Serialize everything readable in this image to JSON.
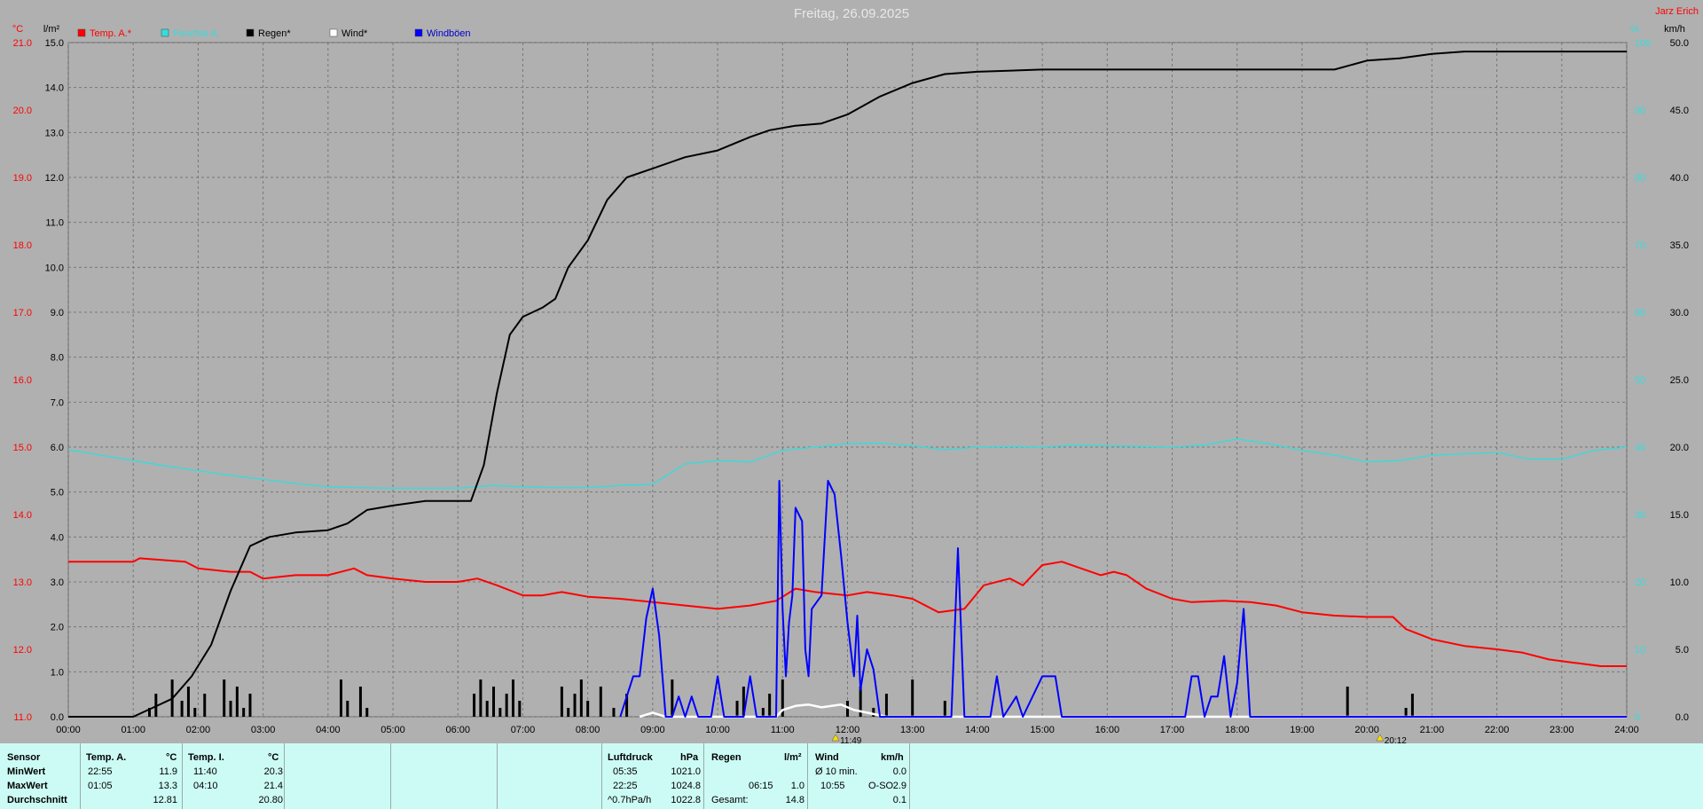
{
  "header": {
    "title": "Freitag, 26.09.2025",
    "author": "Jarz Erich",
    "left_units": [
      "°C",
      "l/m²"
    ],
    "right_units": [
      "%",
      "km/h"
    ]
  },
  "colors": {
    "bg": "#b0b0b0",
    "temp": "#ff0000",
    "humidity": "#33dddd",
    "rain": "#000000",
    "wind": "#ffffff",
    "gust": "#0000ff",
    "panel": "#ccfbf5"
  },
  "chart_data": {
    "type": "line",
    "title": "Freitag, 26.09.2025",
    "x_ticks": [
      "00:00",
      "01:00",
      "02:00",
      "03:00",
      "04:00",
      "05:00",
      "06:00",
      "07:00",
      "08:00",
      "09:00",
      "10:00",
      "11:00",
      "12:00",
      "13:00",
      "14:00",
      "15:00",
      "16:00",
      "17:00",
      "18:00",
      "19:00",
      "20:00",
      "21:00",
      "22:00",
      "23:00",
      "24:00"
    ],
    "xlim": [
      0,
      24
    ],
    "axis_temp": {
      "range": [
        11.0,
        21.0
      ],
      "ticks": [
        "11.0",
        "12.0",
        "13.0",
        "14.0",
        "15.0",
        "16.0",
        "17.0",
        "18.0",
        "19.0",
        "20.0",
        "21.0"
      ]
    },
    "axis_rain": {
      "range": [
        0,
        15.0
      ],
      "ticks": [
        "0.0",
        "1.0",
        "2.0",
        "3.0",
        "4.0",
        "5.0",
        "6.0",
        "7.0",
        "8.0",
        "9.0",
        "10.0",
        "11.0",
        "12.0",
        "13.0",
        "14.0",
        "15.0"
      ]
    },
    "axis_hum": {
      "range": [
        0,
        100
      ],
      "ticks": [
        "0",
        "10",
        "20",
        "30",
        "40",
        "50",
        "60",
        "70",
        "80",
        "90",
        "100"
      ]
    },
    "axis_wind": {
      "range": [
        0,
        50.0
      ],
      "ticks": [
        "0.0",
        "5.0",
        "10.0",
        "15.0",
        "20.0",
        "25.0",
        "30.0",
        "35.0",
        "40.0",
        "45.0",
        "50.0"
      ]
    },
    "legend": [
      "Temp. A.*",
      "Feuchte A.",
      "Regen*",
      "Wind*",
      "Windböen"
    ],
    "markers": [
      "11:49",
      "20:12"
    ],
    "series": [
      {
        "name": "Temp. A.*",
        "axis": "temp",
        "points": [
          [
            0,
            13.3
          ],
          [
            1.0,
            13.3
          ],
          [
            1.1,
            13.35
          ],
          [
            1.8,
            13.3
          ],
          [
            2.0,
            13.2
          ],
          [
            2.5,
            13.15
          ],
          [
            2.8,
            13.15
          ],
          [
            3.0,
            13.05
          ],
          [
            3.5,
            13.1
          ],
          [
            4.0,
            13.1
          ],
          [
            4.4,
            13.2
          ],
          [
            4.6,
            13.1
          ],
          [
            5.0,
            13.05
          ],
          [
            5.5,
            13.0
          ],
          [
            6.0,
            13.0
          ],
          [
            6.3,
            13.05
          ],
          [
            6.6,
            12.95
          ],
          [
            7.0,
            12.8
          ],
          [
            7.3,
            12.8
          ],
          [
            7.6,
            12.85
          ],
          [
            8.0,
            12.78
          ],
          [
            8.5,
            12.75
          ],
          [
            9.0,
            12.7
          ],
          [
            9.5,
            12.65
          ],
          [
            10.0,
            12.6
          ],
          [
            10.5,
            12.65
          ],
          [
            10.9,
            12.72
          ],
          [
            11.2,
            12.9
          ],
          [
            11.5,
            12.85
          ],
          [
            12.0,
            12.8
          ],
          [
            12.3,
            12.85
          ],
          [
            12.7,
            12.8
          ],
          [
            13.0,
            12.75
          ],
          [
            13.4,
            12.55
          ],
          [
            13.8,
            12.6
          ],
          [
            14.1,
            12.95
          ],
          [
            14.5,
            13.05
          ],
          [
            14.7,
            12.95
          ],
          [
            15.0,
            13.25
          ],
          [
            15.3,
            13.3
          ],
          [
            15.6,
            13.2
          ],
          [
            15.9,
            13.1
          ],
          [
            16.1,
            13.15
          ],
          [
            16.3,
            13.1
          ],
          [
            16.6,
            12.9
          ],
          [
            17.0,
            12.75
          ],
          [
            17.3,
            12.7
          ],
          [
            17.8,
            12.72
          ],
          [
            18.2,
            12.7
          ],
          [
            18.6,
            12.65
          ],
          [
            19.0,
            12.55
          ],
          [
            19.5,
            12.5
          ],
          [
            20.0,
            12.48
          ],
          [
            20.4,
            12.48
          ],
          [
            20.6,
            12.3
          ],
          [
            21.0,
            12.15
          ],
          [
            21.5,
            12.05
          ],
          [
            22.0,
            12.0
          ],
          [
            22.4,
            11.95
          ],
          [
            22.8,
            11.85
          ],
          [
            23.2,
            11.8
          ],
          [
            23.6,
            11.75
          ],
          [
            24.0,
            11.75
          ]
        ]
      },
      {
        "name": "Feuchte A.",
        "axis": "hum",
        "points": [
          [
            0,
            39.6
          ],
          [
            0.5,
            38.8
          ],
          [
            1.0,
            38.0
          ],
          [
            1.5,
            37.2
          ],
          [
            2.0,
            36.5
          ],
          [
            2.5,
            35.8
          ],
          [
            3.0,
            35.2
          ],
          [
            3.5,
            34.6
          ],
          [
            4.0,
            34.1
          ],
          [
            4.5,
            34.0
          ],
          [
            5.0,
            33.9
          ],
          [
            5.5,
            33.9
          ],
          [
            6.0,
            33.9
          ],
          [
            6.5,
            34.3
          ],
          [
            7.0,
            34.1
          ],
          [
            7.5,
            34.0
          ],
          [
            8.0,
            34.0
          ],
          [
            8.5,
            34.3
          ],
          [
            9.0,
            34.5
          ],
          [
            9.5,
            37.5
          ],
          [
            10.0,
            38.0
          ],
          [
            10.5,
            37.8
          ],
          [
            11.0,
            39.5
          ],
          [
            11.5,
            40.0
          ],
          [
            12.0,
            40.5
          ],
          [
            12.5,
            40.6
          ],
          [
            13.0,
            40.2
          ],
          [
            13.5,
            39.6
          ],
          [
            14.0,
            40.0
          ],
          [
            14.5,
            40.1
          ],
          [
            15.0,
            40.0
          ],
          [
            15.5,
            40.3
          ],
          [
            16.0,
            40.2
          ],
          [
            16.5,
            40.1
          ],
          [
            17.0,
            40.0
          ],
          [
            17.5,
            40.3
          ],
          [
            18.0,
            41.2
          ],
          [
            18.5,
            40.5
          ],
          [
            19.0,
            39.5
          ],
          [
            19.5,
            38.8
          ],
          [
            20.0,
            37.8
          ],
          [
            20.5,
            38.0
          ],
          [
            21.0,
            38.8
          ],
          [
            21.5,
            39.0
          ],
          [
            22.0,
            39.2
          ],
          [
            22.5,
            38.2
          ],
          [
            23.0,
            38.2
          ],
          [
            23.5,
            39.5
          ],
          [
            24.0,
            40.0
          ]
        ]
      },
      {
        "name": "Regen*",
        "axis": "rain",
        "points": [
          [
            0,
            0
          ],
          [
            1.0,
            0
          ],
          [
            1.3,
            0.2
          ],
          [
            1.6,
            0.4
          ],
          [
            1.9,
            0.9
          ],
          [
            2.2,
            1.6
          ],
          [
            2.5,
            2.8
          ],
          [
            2.8,
            3.8
          ],
          [
            3.1,
            4.0
          ],
          [
            3.5,
            4.1
          ],
          [
            4.0,
            4.15
          ],
          [
            4.3,
            4.3
          ],
          [
            4.6,
            4.6
          ],
          [
            5.0,
            4.7
          ],
          [
            5.5,
            4.8
          ],
          [
            6.0,
            4.8
          ],
          [
            6.2,
            4.8
          ],
          [
            6.4,
            5.6
          ],
          [
            6.6,
            7.2
          ],
          [
            6.8,
            8.5
          ],
          [
            7.0,
            8.9
          ],
          [
            7.3,
            9.1
          ],
          [
            7.5,
            9.3
          ],
          [
            7.7,
            10.0
          ],
          [
            8.0,
            10.6
          ],
          [
            8.3,
            11.5
          ],
          [
            8.6,
            12.0
          ],
          [
            9.0,
            12.2
          ],
          [
            9.5,
            12.45
          ],
          [
            10.0,
            12.6
          ],
          [
            10.5,
            12.9
          ],
          [
            10.8,
            13.05
          ],
          [
            11.2,
            13.15
          ],
          [
            11.6,
            13.2
          ],
          [
            12.0,
            13.4
          ],
          [
            12.5,
            13.8
          ],
          [
            13.0,
            14.1
          ],
          [
            13.5,
            14.3
          ],
          [
            14.0,
            14.35
          ],
          [
            15.0,
            14.4
          ],
          [
            16.0,
            14.4
          ],
          [
            17.0,
            14.4
          ],
          [
            18.0,
            14.4
          ],
          [
            19.0,
            14.4
          ],
          [
            19.5,
            14.4
          ],
          [
            20.0,
            14.6
          ],
          [
            20.5,
            14.65
          ],
          [
            21.0,
            14.75
          ],
          [
            21.5,
            14.8
          ],
          [
            22.0,
            14.8
          ],
          [
            23.0,
            14.8
          ],
          [
            24.0,
            14.8
          ]
        ]
      },
      {
        "name": "Wind*",
        "axis": "wind",
        "points": [
          [
            8.8,
            0
          ],
          [
            9.0,
            0.3
          ],
          [
            9.2,
            0
          ],
          [
            10.9,
            0
          ],
          [
            11.0,
            0.5
          ],
          [
            11.2,
            0.8
          ],
          [
            11.4,
            0.9
          ],
          [
            11.6,
            0.7
          ],
          [
            11.9,
            0.9
          ],
          [
            12.1,
            0.5
          ],
          [
            12.3,
            0.3
          ],
          [
            12.6,
            0
          ],
          [
            24.0,
            0
          ]
        ]
      },
      {
        "name": "Windböen",
        "axis": "gust",
        "points": [
          [
            8.5,
            0
          ],
          [
            8.7,
            3.0
          ],
          [
            8.8,
            3.0
          ],
          [
            8.9,
            7.3
          ],
          [
            9.0,
            9.5
          ],
          [
            9.1,
            6.0
          ],
          [
            9.2,
            0
          ],
          [
            9.3,
            0
          ],
          [
            9.4,
            1.5
          ],
          [
            9.5,
            0
          ],
          [
            9.6,
            1.5
          ],
          [
            9.7,
            0
          ],
          [
            9.9,
            0
          ],
          [
            10.0,
            3.0
          ],
          [
            10.1,
            0
          ],
          [
            10.2,
            0
          ],
          [
            10.4,
            0
          ],
          [
            10.5,
            3.0
          ],
          [
            10.6,
            0
          ],
          [
            10.9,
            0
          ],
          [
            10.95,
            17.5
          ],
          [
            11.0,
            8.0
          ],
          [
            11.05,
            3.0
          ],
          [
            11.1,
            7.0
          ],
          [
            11.15,
            9.0
          ],
          [
            11.2,
            15.5
          ],
          [
            11.3,
            14.5
          ],
          [
            11.35,
            5.0
          ],
          [
            11.4,
            3.0
          ],
          [
            11.45,
            8.0
          ],
          [
            11.6,
            9.0
          ],
          [
            11.7,
            17.5
          ],
          [
            11.8,
            16.5
          ],
          [
            11.9,
            12.0
          ],
          [
            12.0,
            7.0
          ],
          [
            12.1,
            3.0
          ],
          [
            12.15,
            7.5
          ],
          [
            12.2,
            2.0
          ],
          [
            12.3,
            5.0
          ],
          [
            12.4,
            3.5
          ],
          [
            12.5,
            0
          ],
          [
            13.5,
            0
          ],
          [
            13.6,
            0
          ],
          [
            13.7,
            12.5
          ],
          [
            13.8,
            0
          ],
          [
            14.2,
            0
          ],
          [
            14.3,
            3.0
          ],
          [
            14.4,
            0
          ],
          [
            14.6,
            1.5
          ],
          [
            14.7,
            0
          ],
          [
            15.0,
            3.0
          ],
          [
            15.2,
            3.0
          ],
          [
            15.3,
            0
          ],
          [
            17.2,
            0
          ],
          [
            17.3,
            3.0
          ],
          [
            17.4,
            3.0
          ],
          [
            17.5,
            0
          ],
          [
            17.6,
            1.5
          ],
          [
            17.7,
            1.5
          ],
          [
            17.8,
            4.5
          ],
          [
            17.9,
            0
          ],
          [
            18.0,
            2.5
          ],
          [
            18.1,
            8.0
          ],
          [
            18.2,
            0
          ],
          [
            24.0,
            0
          ]
        ]
      }
    ],
    "rain_bars_times": [
      1.25,
      1.35,
      1.6,
      1.75,
      1.85,
      1.95,
      2.1,
      2.4,
      2.5,
      2.6,
      2.7,
      2.8,
      4.2,
      4.3,
      4.5,
      4.6,
      6.25,
      6.35,
      6.45,
      6.55,
      6.65,
      6.75,
      6.85,
      6.95,
      7.6,
      7.7,
      7.8,
      7.9,
      8.0,
      8.2,
      8.4,
      8.6,
      9.3,
      10.3,
      10.4,
      10.7,
      10.8,
      11.0,
      12.0,
      12.2,
      12.4,
      12.6,
      13.0,
      13.5,
      19.7,
      20.6,
      20.7
    ]
  },
  "panel": {
    "sensor": {
      "header": "Sensor",
      "rows": [
        "MinWert",
        "MaxWert",
        "Durchschnitt"
      ]
    },
    "temp_a": {
      "header": "Temp. A.",
      "unit": "°C",
      "times": [
        "22:55",
        "01:05",
        ""
      ],
      "values": [
        "11.9",
        "13.3",
        "12.81"
      ]
    },
    "temp_i": {
      "header": "Temp. I.",
      "unit": "°C",
      "times": [
        "11:40",
        "04:10",
        ""
      ],
      "values": [
        "20.3",
        "21.4",
        "20.80"
      ]
    },
    "pressure": {
      "header": "Luftdruck",
      "unit": "hPa",
      "times": [
        "05:35",
        "22:25",
        "^0.7hPa/h"
      ],
      "values": [
        "1021.0",
        "1024.8",
        "1022.8"
      ]
    },
    "rain": {
      "header": "Regen",
      "unit": "l/m²",
      "times": [
        "",
        "06:15",
        "Gesamt:"
      ],
      "values": [
        "",
        "1.0",
        "14.8"
      ]
    },
    "wind": {
      "header": "Wind",
      "unit": "km/h",
      "times": [
        "Ø 10 min.",
        "10:55",
        ""
      ],
      "dirs": [
        "",
        "O-SO",
        ""
      ],
      "values": [
        "0.0",
        "2.9",
        "0.1"
      ]
    }
  }
}
